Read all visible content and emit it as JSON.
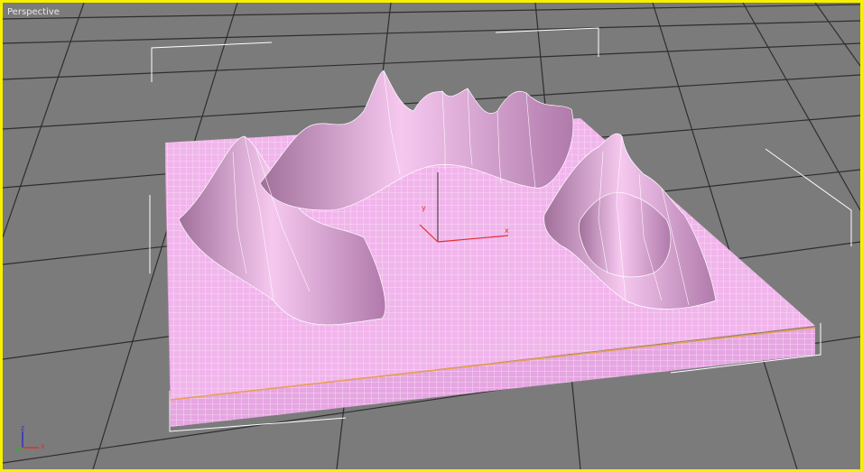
{
  "viewport": {
    "label": "Perspective",
    "active_border_color": "#f6f000",
    "background_color": "#7b7b7b"
  },
  "object": {
    "type": "heightfield-plane",
    "color": "#f3b7ef",
    "wire_color": "#ffffff",
    "edge_color": "#e8a050"
  },
  "gizmo": {
    "label_x": "x",
    "label_y": "y"
  },
  "view_axis": {
    "label_x": "x",
    "label_z": "z"
  },
  "icons": [
    "transform-gizmo-icon",
    "view-axis-tripod-icon"
  ]
}
